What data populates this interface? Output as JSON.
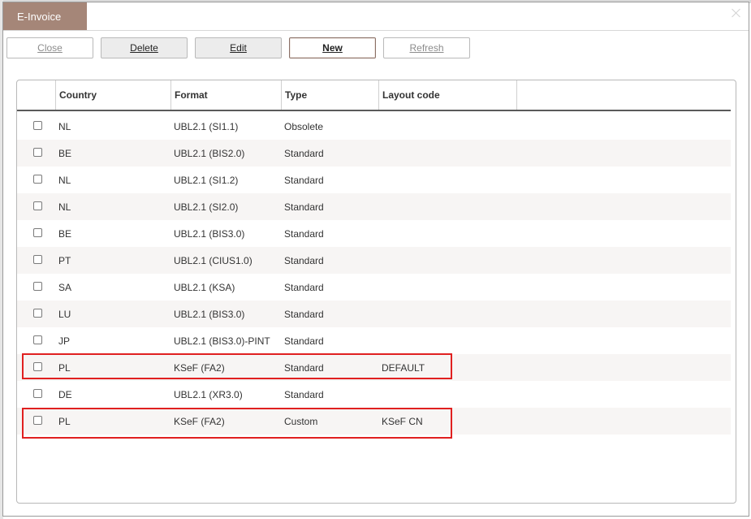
{
  "window": {
    "tab_label": "E-Invoice"
  },
  "toolbar": {
    "close_label": "Close",
    "delete_label": "Delete",
    "edit_label": "Edit",
    "new_label": "New",
    "refresh_label": "Refresh"
  },
  "table": {
    "columns": [
      "",
      "Country",
      "Format",
      "Type",
      "Layout code"
    ],
    "rows": [
      {
        "country": "NL",
        "format": "UBL2.1 (SI1.1)",
        "type": "Obsolete",
        "layout": ""
      },
      {
        "country": "BE",
        "format": "UBL2.1 (BIS2.0)",
        "type": "Standard",
        "layout": ""
      },
      {
        "country": "NL",
        "format": "UBL2.1 (SI1.2)",
        "type": "Standard",
        "layout": ""
      },
      {
        "country": "NL",
        "format": "UBL2.1 (SI2.0)",
        "type": "Standard",
        "layout": ""
      },
      {
        "country": "BE",
        "format": "UBL2.1 (BIS3.0)",
        "type": "Standard",
        "layout": ""
      },
      {
        "country": "PT",
        "format": "UBL2.1 (CIUS1.0)",
        "type": "Standard",
        "layout": ""
      },
      {
        "country": "SA",
        "format": "UBL2.1 (KSA)",
        "type": "Standard",
        "layout": ""
      },
      {
        "country": "LU",
        "format": "UBL2.1 (BIS3.0)",
        "type": "Standard",
        "layout": ""
      },
      {
        "country": "JP",
        "format": "UBL2.1 (BIS3.0)-PINT",
        "type": "Standard",
        "layout": ""
      },
      {
        "country": "PL",
        "format": "KSeF (FA2)",
        "type": "Standard",
        "layout": "DEFAULT"
      },
      {
        "country": "DE",
        "format": "UBL2.1 (XR3.0)",
        "type": "Standard",
        "layout": ""
      },
      {
        "country": "PL",
        "format": "KSeF (FA2)",
        "type": "Custom",
        "layout": "KSeF CN"
      }
    ]
  },
  "colors": {
    "tab": "#a58678",
    "highlight": "#e02020"
  }
}
